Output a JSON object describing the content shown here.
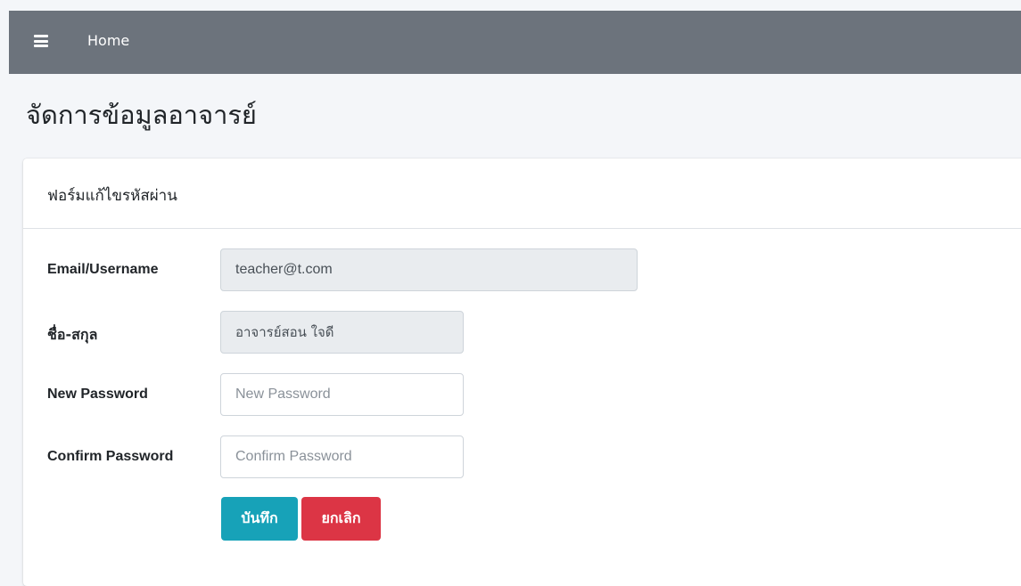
{
  "navbar": {
    "menu_icon": "hamburger-menu-icon",
    "home_label": "Home",
    "background": "#6c737c"
  },
  "page": {
    "title": "จัดการข้อมูลอาจารย์"
  },
  "form": {
    "title": "ฟอร์มแก้ไขรหัสผ่าน",
    "fields": {
      "email": {
        "label": "Email/Username",
        "value": "teacher@t.com",
        "readonly": true
      },
      "fullname": {
        "label": "ชื่อ-สกุล",
        "value": "อาจารย์สอน ใจดี",
        "readonly": true
      },
      "new_password": {
        "label": "New Password",
        "value": "",
        "placeholder": "New Password"
      },
      "confirm_password": {
        "label": "Confirm Password",
        "value": "",
        "placeholder": "Confirm Password"
      }
    },
    "buttons": {
      "save_label": "บันทึก",
      "cancel_label": "ยกเลิก"
    }
  },
  "colors": {
    "save_button": "#17a2b8",
    "cancel_button": "#dc3545",
    "readonly_field": "#e9ecef"
  }
}
